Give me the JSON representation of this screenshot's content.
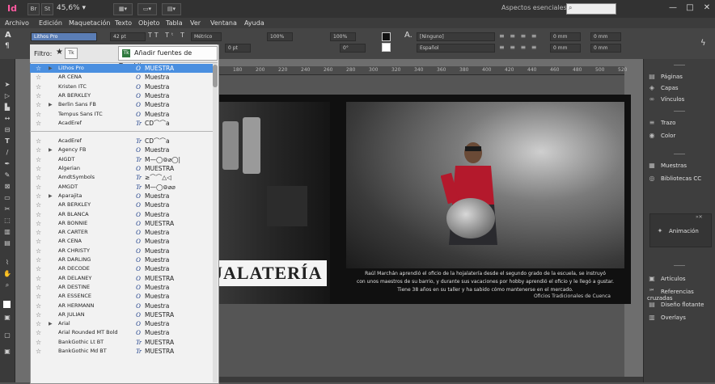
{
  "titlebar": {
    "logo": "Id",
    "zoom": "45,6%",
    "workspace": "Aspectos esenciales",
    "win_min": "—",
    "win_max": "□",
    "win_close": "✕"
  },
  "menu": [
    "Archivo",
    "Edición",
    "Maquetación",
    "Texto",
    "Objeto",
    "Tabla",
    "Ver",
    "Ventana",
    "Ayuda"
  ],
  "control": {
    "font_value": "Lithos Pro",
    "size_value": "42 pt",
    "tracking_value": "Métrico",
    "scale_h": "100%",
    "scale_v": "100%",
    "style_value": "[Ninguno]",
    "language": "Español",
    "leading_value": "0 pt",
    "indent_1": "0 mm",
    "indent_2": "0 mm",
    "indent_3": "0 mm",
    "indent_4": "0 mm",
    "angle": "0°"
  },
  "fontpanel": {
    "filter_label": "Filtro:",
    "filter_star": "★",
    "filter_tk": "Tk",
    "typekit_icon": "Tk",
    "typekit_label": "Añadir fuentes de Typekit",
    "fonts": [
      {
        "name": "Lithos Pro",
        "arrow": "▶",
        "type": "O",
        "sample": "MUESTRA",
        "selected": true
      },
      {
        "name": "AR CENA",
        "arrow": "",
        "type": "O",
        "sample": "Muestra"
      },
      {
        "name": "Kristen ITC",
        "arrow": "",
        "type": "O",
        "sample": "Muestra"
      },
      {
        "name": "AR BERKLEY",
        "arrow": "",
        "type": "O",
        "sample": "Muestra"
      },
      {
        "name": "Berlin Sans FB",
        "arrow": "▶",
        "type": "O",
        "sample": "Muestra"
      },
      {
        "name": "Tempus Sans ITC",
        "arrow": "",
        "type": "O",
        "sample": "Muestra"
      },
      {
        "name": "AcadEref",
        "arrow": "",
        "type": "Tr",
        "sample": "CD⌒⌒a"
      },
      {
        "name": "AcadEref",
        "arrow": "",
        "type": "Tr",
        "sample": "CD⌒⌒a",
        "gap": true
      },
      {
        "name": "Agency FB",
        "arrow": "▶",
        "type": "O",
        "sample": "Muestra"
      },
      {
        "name": "AIGDT",
        "arrow": "",
        "type": "Tr",
        "sample": "M—◯⊚⌀◯|"
      },
      {
        "name": "Algerian",
        "arrow": "",
        "type": "O",
        "sample": "MUESTRA"
      },
      {
        "name": "AmdtSymbols",
        "arrow": "",
        "type": "Tr",
        "sample": "≥⌒⌒△◁"
      },
      {
        "name": "AMGDT",
        "arrow": "",
        "type": "Tr",
        "sample": "M—◯⊚⌀⌀"
      },
      {
        "name": "Aparajita",
        "arrow": "▶",
        "type": "O",
        "sample": "Muestra"
      },
      {
        "name": "AR BERKLEY",
        "arrow": "",
        "type": "O",
        "sample": "Muestra"
      },
      {
        "name": "AR BLANCA",
        "arrow": "",
        "type": "O",
        "sample": "Muestra"
      },
      {
        "name": "AR BONNIE",
        "arrow": "",
        "type": "O",
        "sample": "MUESTRA"
      },
      {
        "name": "AR CARTER",
        "arrow": "",
        "type": "O",
        "sample": "Muestra"
      },
      {
        "name": "AR CENA",
        "arrow": "",
        "type": "O",
        "sample": "Muestra"
      },
      {
        "name": "AR CHRISTY",
        "arrow": "",
        "type": "O",
        "sample": "Muestra"
      },
      {
        "name": "AR DARLING",
        "arrow": "",
        "type": "O",
        "sample": "Muestra"
      },
      {
        "name": "AR DECODE",
        "arrow": "",
        "type": "O",
        "sample": "Muestra"
      },
      {
        "name": "AR DELANEY",
        "arrow": "",
        "type": "O",
        "sample": "MUESTRA"
      },
      {
        "name": "AR DESTINE",
        "arrow": "",
        "type": "O",
        "sample": "Muestra"
      },
      {
        "name": "AR ESSENCE",
        "arrow": "",
        "type": "O",
        "sample": "Muestra"
      },
      {
        "name": "AR HERMANN",
        "arrow": "",
        "type": "O",
        "sample": "Muestra"
      },
      {
        "name": "AR JULIAN",
        "arrow": "",
        "type": "O",
        "sample": "MUESTRA"
      },
      {
        "name": "Arial",
        "arrow": "▶",
        "type": "O",
        "sample": "Muestra"
      },
      {
        "name": "Arial Rounded MT Bold",
        "arrow": "",
        "type": "O",
        "sample": "Muestra"
      },
      {
        "name": "BankGothic Lt BT",
        "arrow": "",
        "type": "Tr",
        "sample": "MUESTRA"
      },
      {
        "name": "BankGothic Md BT",
        "arrow": "",
        "type": "Tr",
        "sample": "MUESTRA"
      }
    ]
  },
  "ruler": [
    "180",
    "200",
    "220",
    "240",
    "260",
    "280",
    "300",
    "320",
    "340",
    "360",
    "380",
    "400",
    "420",
    "440",
    "460",
    "480",
    "500",
    "520"
  ],
  "document": {
    "title": "JALATERÍA",
    "caption_lines": [
      "Raúl Marchán aprendió el oficio de la hojalatería desde el segundo grado de la escuela, se instruyó",
      "con unos maestros de su barrio, y durante sus vacaciones por hobby aprendió el oficio y le llegó a gustar.",
      "Tiene 38 años en su taller y ha sabido cómo mantenerse en el mercado."
    ],
    "credit": "Oficios Tradicionales de Cuenca"
  },
  "panels": {
    "group1": [
      {
        "icon": "pages-icon",
        "glyph": "▤",
        "label": "Páginas"
      },
      {
        "icon": "layers-icon",
        "glyph": "◈",
        "label": "Capas"
      },
      {
        "icon": "links-icon",
        "glyph": "∞",
        "label": "Vínculos"
      }
    ],
    "group2": [
      {
        "icon": "stroke-icon",
        "glyph": "≡",
        "label": "Trazo"
      },
      {
        "icon": "color-icon",
        "glyph": "◉",
        "label": "Color"
      }
    ],
    "group3": [
      {
        "icon": "swatches-icon",
        "glyph": "▦",
        "label": "Muestras"
      },
      {
        "icon": "cc-libraries-icon",
        "glyph": "◎",
        "label": "Bibliotecas CC"
      }
    ],
    "animation": {
      "icon": "animation-icon",
      "glyph": "✦",
      "label": "Animación"
    },
    "group4": [
      {
        "icon": "articles-icon",
        "glyph": "▣",
        "label": "Artículos"
      },
      {
        "icon": "cross-references-icon",
        "glyph": "℠",
        "label": "Referencias cruzadas"
      },
      {
        "icon": "floating-design-icon",
        "glyph": "▤",
        "label": "Diseño flotante"
      },
      {
        "icon": "overlays-icon",
        "glyph": "▥",
        "label": "Overlays"
      }
    ]
  }
}
